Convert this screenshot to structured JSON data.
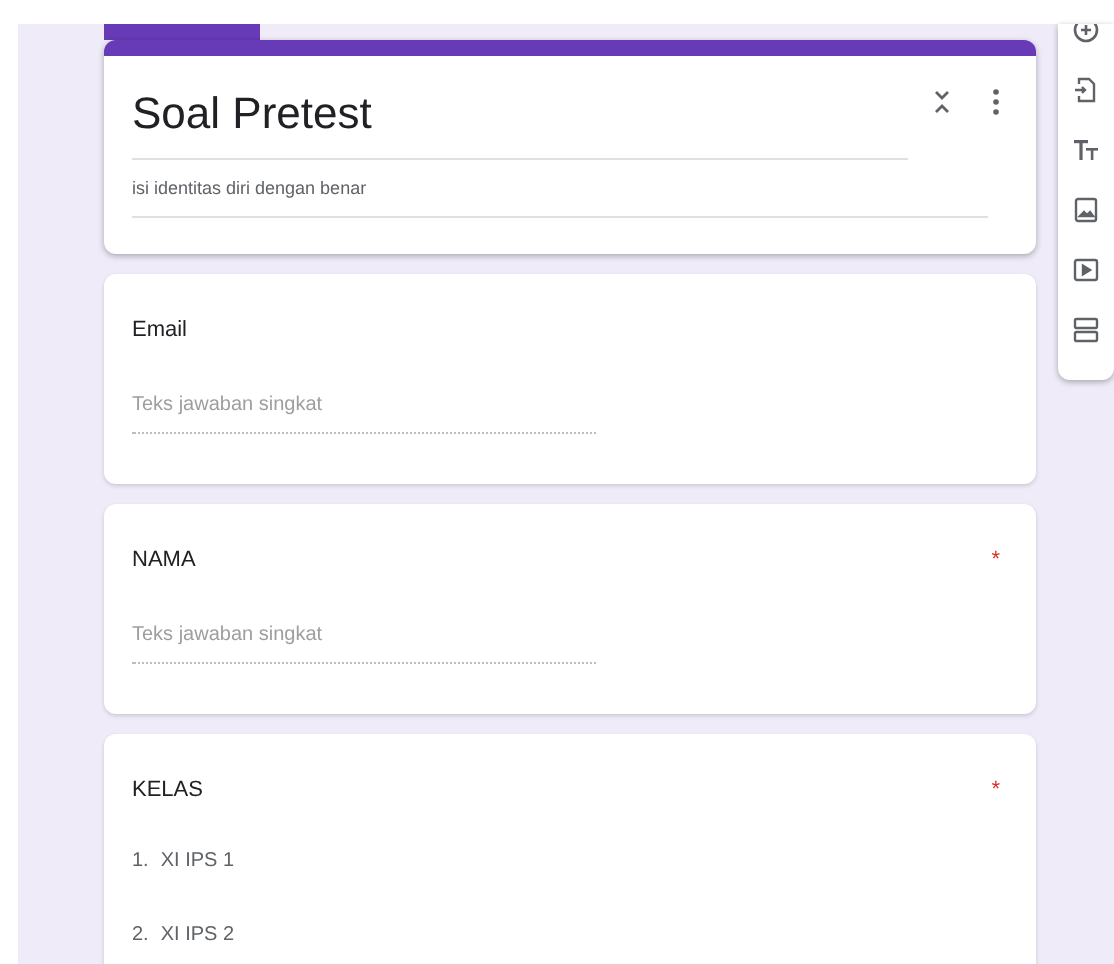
{
  "required_symbol": "*",
  "header": {
    "title": "Soal Pretest",
    "description": "isi identitas diri dengan benar"
  },
  "questions": [
    {
      "kind": "short",
      "title": "Email",
      "required": false,
      "placeholder": "Teks jawaban singkat"
    },
    {
      "kind": "short",
      "title": "NAMA",
      "required": true,
      "placeholder": "Teks jawaban singkat"
    },
    {
      "kind": "list",
      "title": "KELAS",
      "required": true,
      "options": [
        {
          "number": "1.",
          "label": "XI IPS 1"
        },
        {
          "number": "2.",
          "label": "XI IPS 2"
        }
      ]
    }
  ]
}
